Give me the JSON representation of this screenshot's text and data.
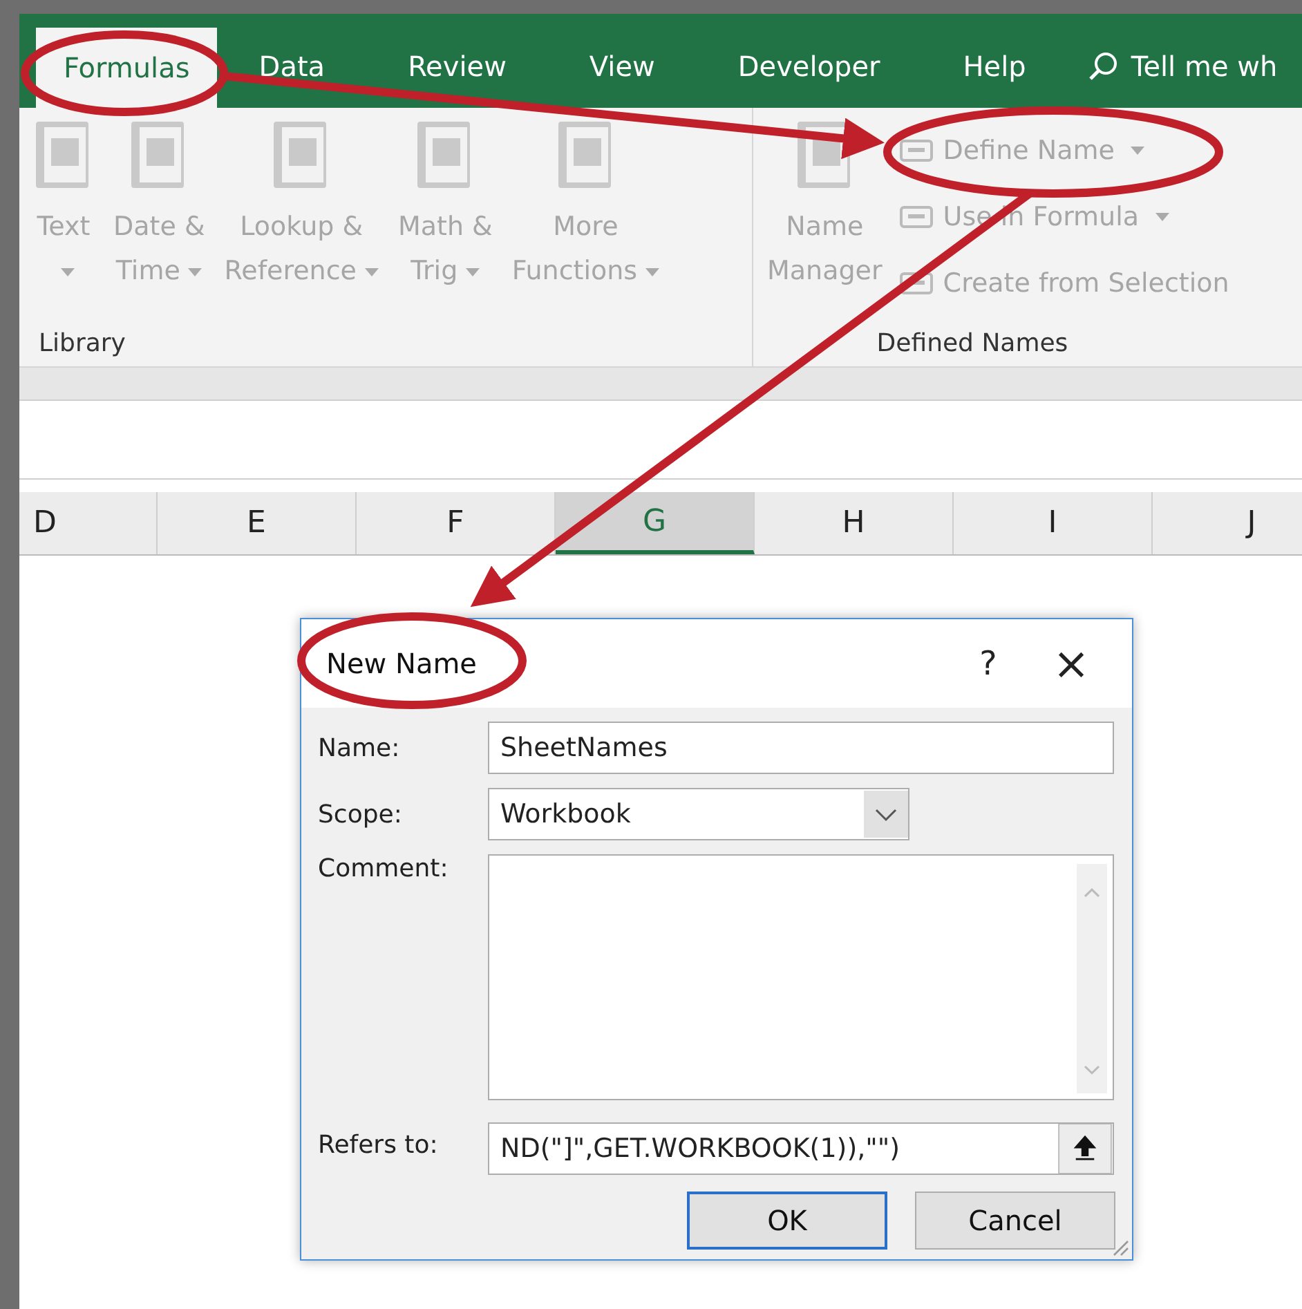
{
  "tabs": [
    {
      "label": "Formulas",
      "selected": true
    },
    {
      "label": "Data",
      "selected": false
    },
    {
      "label": "Review",
      "selected": false
    },
    {
      "label": "View",
      "selected": false
    },
    {
      "label": "Developer",
      "selected": false
    },
    {
      "label": "Help",
      "selected": false
    }
  ],
  "tell_me": "Tell me wh",
  "ribbon": {
    "groups": [
      {
        "label": "Library",
        "buttons": [
          {
            "kind": "big",
            "label": "Text",
            "dropdown": true,
            "disabled": true
          },
          {
            "kind": "big",
            "label": "Date &",
            "label2": "Time",
            "dropdown": true,
            "disabled": true
          },
          {
            "kind": "big",
            "label": "Lookup &",
            "label2": "Reference",
            "dropdown": true,
            "disabled": true
          },
          {
            "kind": "big",
            "label": "Math &",
            "label2": "Trig",
            "dropdown": true,
            "disabled": true
          },
          {
            "kind": "big",
            "label": "More",
            "label2": "Functions",
            "dropdown": true,
            "disabled": true
          }
        ]
      },
      {
        "label": "Defined Names",
        "buttons": [
          {
            "kind": "big",
            "label": "Name",
            "label2": "Manager",
            "dropdown": false,
            "disabled": true
          },
          {
            "kind": "small",
            "label": "Define Name",
            "dropdown": true,
            "disabled": true
          },
          {
            "kind": "small",
            "label": "Use in Formula",
            "dropdown": true,
            "disabled": true
          },
          {
            "kind": "small",
            "label": "Create from Selection",
            "dropdown": false,
            "disabled": true
          }
        ]
      }
    ]
  },
  "columns": [
    {
      "label": "D",
      "selected": false
    },
    {
      "label": "E",
      "selected": false
    },
    {
      "label": "F",
      "selected": false
    },
    {
      "label": "G",
      "selected": true
    },
    {
      "label": "H",
      "selected": false
    },
    {
      "label": "I",
      "selected": false
    },
    {
      "label": "J",
      "selected": false
    }
  ],
  "dialog": {
    "title": "New Name",
    "help": "?",
    "close": "×",
    "name_label": "Name:",
    "name_value": "SheetNames",
    "scope_label": "Scope:",
    "scope_value": "Workbook",
    "comment_label": "Comment:",
    "refers_label": "Refers to:",
    "refers_value": "ND(\"]\",GET.WORKBOOK(1)),\"\")",
    "buttons": [
      {
        "label": "OK",
        "default": true
      },
      {
        "label": "Cancel",
        "default": false
      }
    ]
  }
}
